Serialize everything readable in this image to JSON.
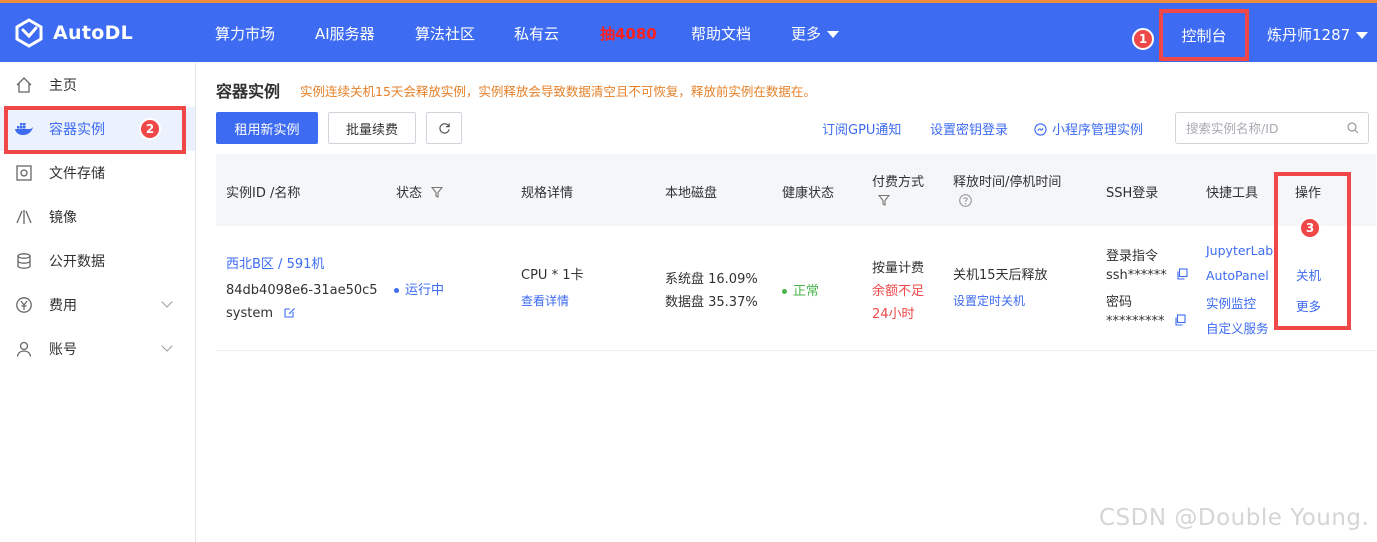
{
  "brand": {
    "name": "AutoDL"
  },
  "nav": {
    "items": [
      "算力市场",
      "AI服务器",
      "算法社区",
      "私有云",
      "抽4080",
      "帮助文档",
      "更多"
    ],
    "console": "控制台",
    "user": "炼丹师1287"
  },
  "annotations": {
    "one": "1",
    "two": "2",
    "three": "3"
  },
  "sidebar": {
    "items": [
      {
        "label": "主页",
        "icon": "home-icon"
      },
      {
        "label": "容器实例",
        "icon": "docker-icon"
      },
      {
        "label": "文件存储",
        "icon": "storage-icon"
      },
      {
        "label": "镜像",
        "icon": "image-icon"
      },
      {
        "label": "公开数据",
        "icon": "database-icon"
      },
      {
        "label": "费用",
        "icon": "yen-icon"
      },
      {
        "label": "账号",
        "icon": "user-icon"
      }
    ],
    "active_index": 1
  },
  "page": {
    "title": "容器实例",
    "warning": "实例连续关机15天会释放实例，实例释放会导致数据清空且不可恢复，释放前实例在数据在。"
  },
  "toolbar": {
    "rent": "租用新实例",
    "renew": "批量续费",
    "gpu_notify": "订阅GPU通知",
    "ssh_key": "设置密钥登录",
    "mini_program": "小程序管理实例",
    "search_placeholder": "搜索实例名称/ID"
  },
  "table": {
    "headers": {
      "id": "实例ID /名称",
      "status": "状态",
      "spec": "规格详情",
      "disk": "本地磁盘",
      "health": "健康状态",
      "billing_1": "付费方式",
      "release": "释放时间/停机时间",
      "ssh": "SSH登录",
      "tools": "快捷工具",
      "ops": "操作"
    },
    "row": {
      "region": "西北B区 / 591机",
      "id": "84db4098e6-31ae50c5",
      "name": "system",
      "status": "运行中",
      "spec": "CPU * 1卡",
      "spec_link": "查看详情",
      "sys_disk": "系统盘 16.09%",
      "data_disk": "数据盘 35.37%",
      "health": "正常",
      "billing": "按量计费",
      "balance_warn_1": "余额不足",
      "balance_warn_2": "24小时",
      "release": "关机15天后释放",
      "schedule": "设置定时关机",
      "ssh_cmd_label": "登录指令",
      "ssh_cmd": "ssh******",
      "pwd_label": "密码",
      "pwd": "*********",
      "tools": [
        "JupyterLab",
        "AutoPanel",
        "实例监控",
        "自定义服务"
      ],
      "ops": [
        "关机",
        "更多"
      ]
    }
  },
  "watermark": "CSDN @Double Young."
}
